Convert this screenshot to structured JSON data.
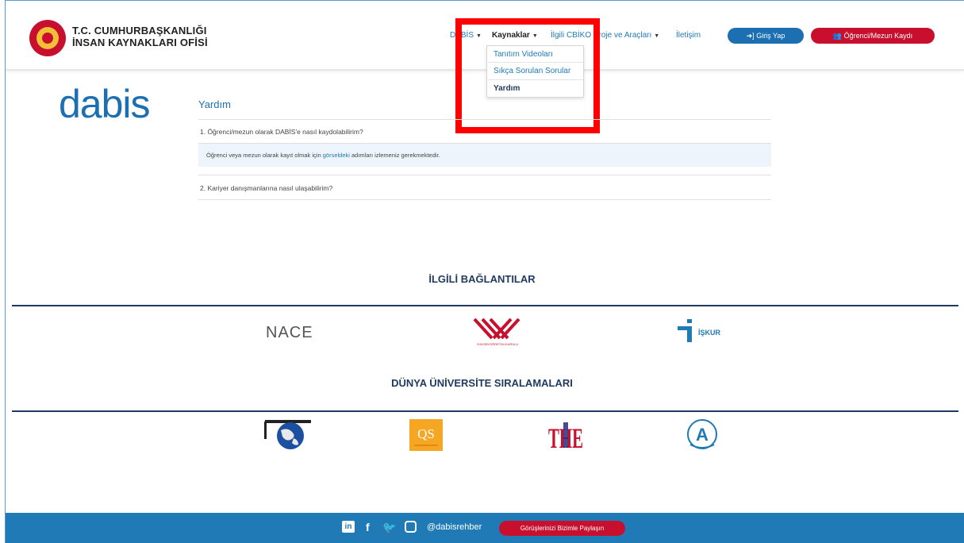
{
  "header": {
    "org_line1": "T.C. CUMHURBAŞKANLIĞI",
    "org_line2": "İNSAN KAYNAKLARI OFİSİ",
    "nav": {
      "dabis": "DABİS",
      "kaynaklar": "Kaynaklar",
      "ilgili": "İlgili CBİKO Proje ve Araçları",
      "iletisim": "İletişim"
    },
    "login_button": "Giriş Yap",
    "register_button": "Öğrenci/Mezun Kaydı"
  },
  "dropdown": {
    "items": [
      "Tanıtım Videoları",
      "Sıkça Sorulan Sorular",
      "Yardım"
    ]
  },
  "main": {
    "logo_text": "dabis",
    "page_title": "Yardım",
    "faq": [
      {
        "question": "1. Öğrenci/mezun olarak DABİS'e nasıl kaydolabilirim?"
      },
      {
        "question": "2. Kariyer danışmanlarına nasıl ulaşabilirim?"
      }
    ],
    "answer_prefix": "Öğrenci veya mezun olarak kayıt olmak için ",
    "answer_link": "görseldeki",
    "answer_suffix": " adımları izlemeniz gerekmektedir."
  },
  "links_section": {
    "title": "İLGİLİ BAĞLANTILAR",
    "nace": "NACE",
    "iskur": "İŞKUR",
    "yok_caption": "YÜKSEKÖĞRETİM KURULU"
  },
  "rankings_section": {
    "title": "DÜNYA ÜNİVERSİTE SIRALAMALARI",
    "qs": "QS",
    "the": "THE"
  },
  "footer": {
    "handle": "@dabisrehber",
    "feedback_button": "Görüşlerinizi Bizimle Paylaşın",
    "icons": [
      "linkedin-icon",
      "facebook-icon",
      "twitter-icon",
      "instagram-icon"
    ]
  },
  "colors": {
    "primary_blue": "#1f7ab5",
    "accent_red": "#c8102e",
    "navy": "#1e3a5f"
  }
}
